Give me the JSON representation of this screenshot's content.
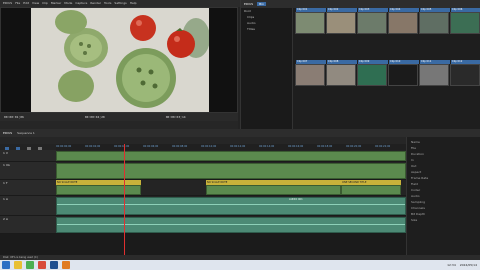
{
  "app": {
    "menubar": [
      "EDIUS",
      "File",
      "Edit",
      "View",
      "Clip",
      "Marker",
      "Mode",
      "Capture",
      "Render",
      "Tools",
      "Settings",
      "Help"
    ],
    "player_label": "PLR",
    "recorder_label": "REC"
  },
  "monitor": {
    "timecode_in": "00:00:01;06",
    "timecode_out": "00:00:04;20",
    "timecode_dur": "00:00:03;14"
  },
  "bin": {
    "title": "EDIUS",
    "tab": "Bin",
    "tree_items": [
      "Root",
      "Clips",
      "Audio",
      "Titles"
    ],
    "clips": [
      {
        "label": "Clip 001",
        "color": "#7d8b72"
      },
      {
        "label": "Clip 002",
        "color": "#9a8f7a"
      },
      {
        "label": "Clip 003",
        "color": "#6c7b6a"
      },
      {
        "label": "Clip 004",
        "color": "#877768"
      },
      {
        "label": "Clip 005",
        "color": "#5f6e63"
      },
      {
        "label": "Clip 006",
        "color": "#3c6e54"
      },
      {
        "label": "Clip 007",
        "color": "#8a7d74"
      },
      {
        "label": "Clip 008",
        "color": "#918a80"
      },
      {
        "label": "Clip 009",
        "color": "#2f6e52"
      },
      {
        "label": "Clip 010",
        "color": "#1b1b1b"
      },
      {
        "label": "Clip 011",
        "color": "#777777"
      },
      {
        "label": "Clip 012",
        "color": "#2a2a2a"
      }
    ]
  },
  "timeline": {
    "title": "EDIUS",
    "sequence": "Sequence 1",
    "ruler": [
      "00:00:00;00",
      "00:00:02;00",
      "00:00:04;00",
      "00:00:06;00",
      "00:00:08;00",
      "00:00:10;00",
      "00:00:12;00",
      "00:00:14;00",
      "00:00:16;00",
      "00:00:18;00",
      "00:00:20;00",
      "00:00:22;00"
    ],
    "tracks": [
      {
        "name": "1 V",
        "type": "video"
      },
      {
        "name": "1 VA",
        "type": "video"
      },
      {
        "name": "1 T",
        "type": "title"
      },
      {
        "name": "1 A",
        "type": "audio"
      },
      {
        "name": "2 A",
        "type": "audio"
      }
    ],
    "title_clips": [
      "NO SCALE NOTE",
      "NO SCALE NOTE",
      "ONE SECOND TITLE"
    ],
    "audio_clip": "AUDIO 001"
  },
  "properties": {
    "rows": [
      "Name",
      "File",
      "Duration",
      "In",
      "Out",
      "Aspect",
      "Frame Rate",
      "Field",
      "Codec",
      "Audio",
      "Sampling",
      "Channels",
      "Bit Depth",
      "Size"
    ]
  },
  "statusbar": {
    "text": "Disk: 45% is being used (C:)"
  },
  "taskbar": {
    "time": "12:34",
    "date": "2024/05/14"
  },
  "colors": {
    "accent": "#3a6aa3",
    "video_clip": "#5b8a4e",
    "title_clip": "#c9b23a",
    "audio_clip": "#4c8a75",
    "playhead": "#e03030"
  }
}
